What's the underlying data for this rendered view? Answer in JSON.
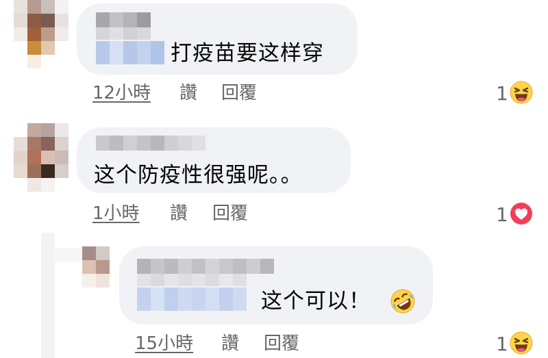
{
  "comments": [
    {
      "text": "打疫苗要这样穿",
      "time": "12小時",
      "like_label": "讚",
      "reply_label": "回覆",
      "reaction_count": "1",
      "reaction_icon": "laughing-emoji-icon"
    },
    {
      "text": "这个防疫性很强呢。。",
      "time": "1小時",
      "like_label": "讚",
      "reply_label": "回覆",
      "reaction_count": "1",
      "reaction_icon": "heart-reaction-icon"
    },
    {
      "text": "这个可以！",
      "emoji": "rolling-on-floor-laughing-emoji-icon",
      "time": "15小時",
      "like_label": "讚",
      "reply_label": "回覆",
      "reaction_count": "1",
      "reaction_icon": "laughing-emoji-icon"
    }
  ],
  "colors": {
    "bubble": "#f0f2f5",
    "meta_text": "#65676b",
    "heart_red": "#f33e58",
    "emoji_yellow": "#fcd54a"
  }
}
